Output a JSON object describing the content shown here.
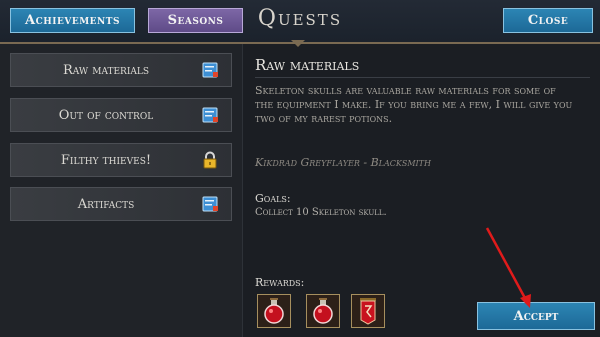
{
  "header": {
    "achievements_label": "Achievements",
    "seasons_label": "Seasons",
    "title": "Quests",
    "close_label": "Close"
  },
  "quests": [
    {
      "label": "Raw materials",
      "icon": "book-icon"
    },
    {
      "label": "Out of control",
      "icon": "book-icon"
    },
    {
      "label": "Filthy thieves!",
      "icon": "lock-icon"
    },
    {
      "label": "Artifacts",
      "icon": "book-icon"
    }
  ],
  "detail": {
    "title": "Raw materials",
    "description": "Skeleton skulls are valuable raw materials for some of the equipment I make. If you bring me a few, I will give you two of my rarest potions.",
    "author": "Kikdrad Greyflayer - Blacksmith",
    "goals_heading": "Goals:",
    "goals_text": "Collect 10 Skeleton skull.",
    "rewards_heading": "Rewards:",
    "rewards": [
      "health-potion-icon",
      "health-potion-icon",
      "red-banner-icon"
    ],
    "accept_label": "Accept"
  },
  "colors": {
    "tab_blue": "#2176a6",
    "tab_purple": "#6e58a0",
    "annotation_arrow": "#e01b1b"
  }
}
